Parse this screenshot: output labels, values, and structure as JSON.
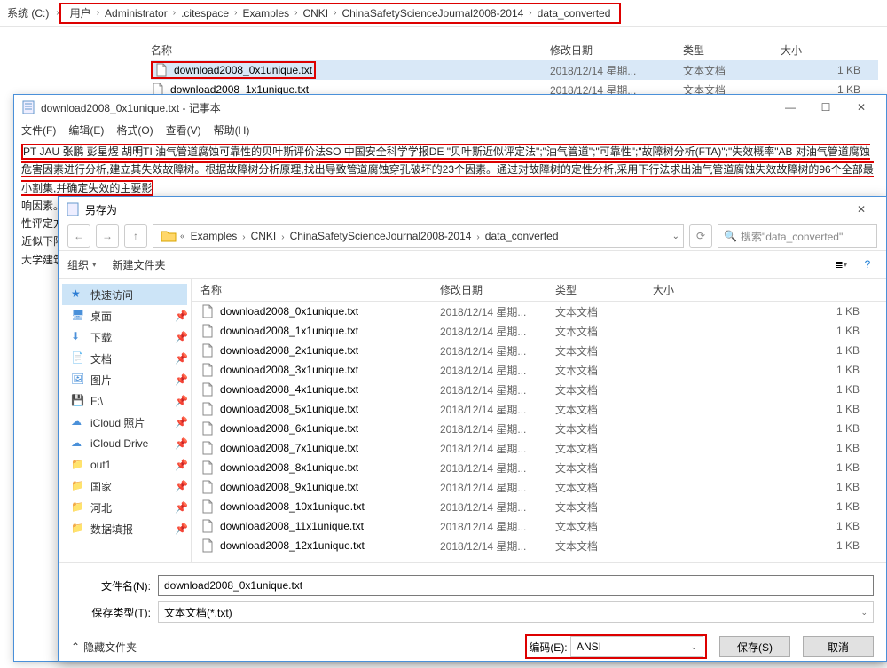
{
  "topExplorer": {
    "sysLabel": "系统 (C:)",
    "crumbs": [
      "用户",
      "Administrator",
      ".citespace",
      "Examples",
      "CNKI",
      "ChinaSafetyScienceJournal2008-2014",
      "data_converted"
    ],
    "headers": {
      "name": "名称",
      "date": "修改日期",
      "type": "类型",
      "size": "大小"
    },
    "rows": [
      {
        "name": "download2008_0x1unique.txt",
        "date": "2018/12/14 星期...",
        "type": "文本文档",
        "size": "1 KB",
        "highlighted": true
      },
      {
        "name": "download2008_1x1unique.txt",
        "date": "2018/12/14 星期...",
        "type": "文本文档",
        "size": "1 KB",
        "highlighted": false
      }
    ]
  },
  "notepad": {
    "title": "download2008_0x1unique.txt - 记事本",
    "menu": [
      "文件(F)",
      "编辑(E)",
      "格式(O)",
      "查看(V)",
      "帮助(H)"
    ],
    "boxed": "PT JAU 张鹏   彭星煜   胡明TI 油气管道腐蚀可靠性的贝叶斯评价法SO 中国安全科学学报DE \"贝叶斯近似评定法\";\"油气管道\";\"可靠性\";\"故障树分析(FTA)\";\"失效概率\"AB 对油气管道腐蚀危害因素进行分析,建立其失效故障树。根据故障树分析原理,找出导致管道腐蚀穿孔破坏的23个因素。通过对故障树的定性分析,采用下行法求出油气管道腐蚀失效故障树的96个全部最小割集,并确定失效的主要影",
    "tail1": "响因素。",
    "tail2": "性评定方",
    "tail3": "近似下限",
    "tail4": "大学建筑"
  },
  "saveAs": {
    "title": "另存为",
    "pathCrumbs": [
      "Examples",
      "CNKI",
      "ChinaSafetyScienceJournal2008-2014",
      "data_converted"
    ],
    "searchPlaceholder": "搜索\"data_converted\"",
    "toolbar": {
      "org": "组织",
      "newFolder": "新建文件夹"
    },
    "sidebar": [
      {
        "label": "快速访问",
        "icon": "star",
        "sel": true
      },
      {
        "label": "桌面",
        "icon": "desktop",
        "pin": true
      },
      {
        "label": "下载",
        "icon": "download",
        "pin": true
      },
      {
        "label": "文档",
        "icon": "doc",
        "pin": true
      },
      {
        "label": "图片",
        "icon": "pic",
        "pin": true
      },
      {
        "label": "F:\\",
        "icon": "drive",
        "pin": true
      },
      {
        "label": "iCloud 照片",
        "icon": "cloud",
        "pin": true
      },
      {
        "label": "iCloud Drive",
        "icon": "cloud",
        "pin": true
      },
      {
        "label": "out1",
        "icon": "folder",
        "pin": true
      },
      {
        "label": "国家",
        "icon": "folder",
        "pin": true
      },
      {
        "label": "河北",
        "icon": "folder",
        "pin": true
      },
      {
        "label": "数据填报",
        "icon": "folder",
        "pin": true
      }
    ],
    "headers": {
      "name": "名称",
      "date": "修改日期",
      "type": "类型",
      "size": "大小"
    },
    "rows": [
      {
        "name": "download2008_0x1unique.txt",
        "date": "2018/12/14 星期...",
        "type": "文本文档",
        "size": "1 KB"
      },
      {
        "name": "download2008_1x1unique.txt",
        "date": "2018/12/14 星期...",
        "type": "文本文档",
        "size": "1 KB"
      },
      {
        "name": "download2008_2x1unique.txt",
        "date": "2018/12/14 星期...",
        "type": "文本文档",
        "size": "1 KB"
      },
      {
        "name": "download2008_3x1unique.txt",
        "date": "2018/12/14 星期...",
        "type": "文本文档",
        "size": "1 KB"
      },
      {
        "name": "download2008_4x1unique.txt",
        "date": "2018/12/14 星期...",
        "type": "文本文档",
        "size": "1 KB"
      },
      {
        "name": "download2008_5x1unique.txt",
        "date": "2018/12/14 星期...",
        "type": "文本文档",
        "size": "1 KB"
      },
      {
        "name": "download2008_6x1unique.txt",
        "date": "2018/12/14 星期...",
        "type": "文本文档",
        "size": "1 KB"
      },
      {
        "name": "download2008_7x1unique.txt",
        "date": "2018/12/14 星期...",
        "type": "文本文档",
        "size": "1 KB"
      },
      {
        "name": "download2008_8x1unique.txt",
        "date": "2018/12/14 星期...",
        "type": "文本文档",
        "size": "1 KB"
      },
      {
        "name": "download2008_9x1unique.txt",
        "date": "2018/12/14 星期...",
        "type": "文本文档",
        "size": "1 KB"
      },
      {
        "name": "download2008_10x1unique.txt",
        "date": "2018/12/14 星期...",
        "type": "文本文档",
        "size": "1 KB"
      },
      {
        "name": "download2008_11x1unique.txt",
        "date": "2018/12/14 星期...",
        "type": "文本文档",
        "size": "1 KB"
      },
      {
        "name": "download2008_12x1unique.txt",
        "date": "2018/12/14 星期...",
        "type": "文本文档",
        "size": "1 KB"
      }
    ],
    "fileNameLabel": "文件名(N):",
    "fileNameValue": "download2008_0x1unique.txt",
    "saveTypeLabel": "保存类型(T):",
    "saveTypeValue": "文本文档(*.txt)",
    "hideFolders": "隐藏文件夹",
    "encodingLabel": "编码(E):",
    "encodingValue": "ANSI",
    "saveBtn": "保存(S)",
    "cancelBtn": "取消"
  }
}
